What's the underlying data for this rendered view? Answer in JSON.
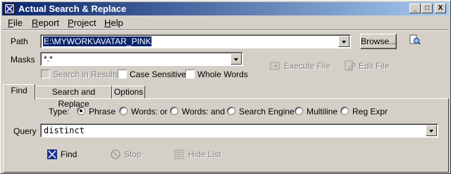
{
  "window": {
    "title": "Actual Search & Replace"
  },
  "titlebar_buttons": {
    "minimize": "_",
    "maximize": "□",
    "close": "X"
  },
  "menu": [
    {
      "label_u": "F",
      "label_rest": "ile"
    },
    {
      "label_u": "R",
      "label_rest": "eport"
    },
    {
      "label_u": "P",
      "label_rest": "roject"
    },
    {
      "label_u": "H",
      "label_rest": "elp"
    }
  ],
  "path": {
    "label": "Path",
    "value": "E:\\MYWORK\\AVATAR_PINK"
  },
  "browse_label": "Browse...",
  "masks": {
    "label": "Masks",
    "value": "*.*"
  },
  "options": {
    "search_in_results": "Search in Results",
    "case_sensitive": "Case Sensitive",
    "whole_words": "Whole Words"
  },
  "actions": {
    "execute_file": "Execute File",
    "edit_file": "Edit File"
  },
  "tabs": [
    "Find",
    "Search and Replace",
    "Options"
  ],
  "type": {
    "label": "Type:",
    "options": [
      "Phrase",
      "Words: or",
      "Words: and",
      "Search Engine",
      "Multiline",
      "Reg Expr"
    ],
    "selected": "Phrase"
  },
  "query": {
    "label": "Query",
    "value": "distinct"
  },
  "bottom_buttons": {
    "find": "Find",
    "stop": "Stop",
    "hide_list": "Hide List"
  }
}
